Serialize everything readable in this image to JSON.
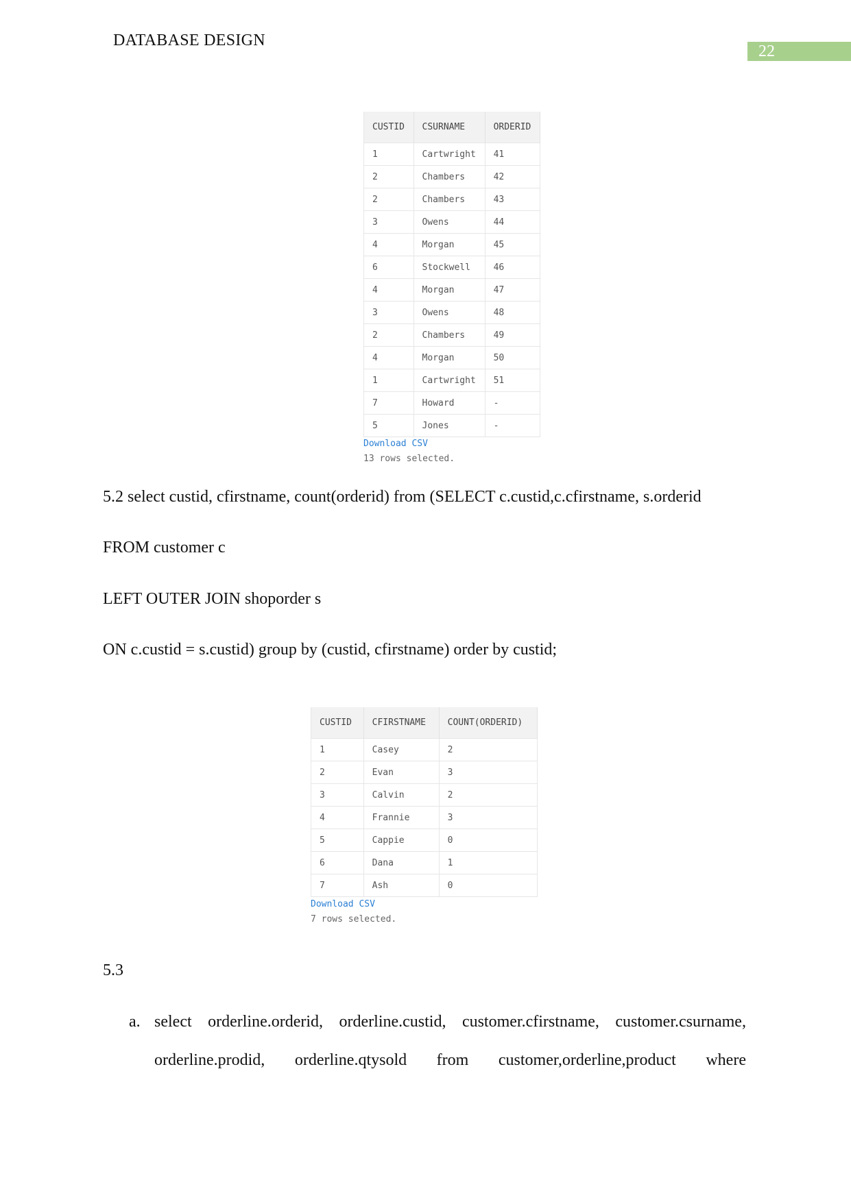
{
  "header": {
    "title": "DATABASE DESIGN",
    "page_number": "22"
  },
  "table1": {
    "columns": [
      "CUSTID",
      "CSURNAME",
      "ORDERID"
    ],
    "rows": [
      [
        "1",
        "Cartwright",
        "41"
      ],
      [
        "2",
        "Chambers",
        "42"
      ],
      [
        "2",
        "Chambers",
        "43"
      ],
      [
        "3",
        "Owens",
        "44"
      ],
      [
        "4",
        "Morgan",
        "45"
      ],
      [
        "6",
        "Stockwell",
        "46"
      ],
      [
        "4",
        "Morgan",
        "47"
      ],
      [
        "3",
        "Owens",
        "48"
      ],
      [
        "2",
        "Chambers",
        "49"
      ],
      [
        "4",
        "Morgan",
        "50"
      ],
      [
        "1",
        "Cartwright",
        "51"
      ],
      [
        "7",
        "Howard",
        "-"
      ],
      [
        "5",
        "Jones",
        "-"
      ]
    ],
    "download": "Download CSV",
    "status": "13 rows selected."
  },
  "query52": [
    "5.2 select custid, cfirstname, count(orderid) from (SELECT c.custid,c.cfirstname, s.orderid",
    "FROM customer c",
    "LEFT OUTER JOIN shoporder s",
    "ON c.custid = s.custid) group by (custid, cfirstname) order by custid;"
  ],
  "table2": {
    "columns": [
      "CUSTID",
      "CFIRSTNAME",
      "COUNT(ORDERID)"
    ],
    "rows": [
      [
        "1",
        "Casey",
        "2"
      ],
      [
        "2",
        "Evan",
        "3"
      ],
      [
        "3",
        "Calvin",
        "2"
      ],
      [
        "4",
        "Frannie",
        "3"
      ],
      [
        "5",
        "Cappie",
        "0"
      ],
      [
        "6",
        "Dana",
        "1"
      ],
      [
        "7",
        "Ash",
        "0"
      ]
    ],
    "download": "Download CSV",
    "status": "7 rows selected."
  },
  "section53": {
    "heading": "5.3",
    "item_marker": "a.",
    "line1": [
      "select",
      "orderline.orderid,",
      "orderline.custid,",
      "customer.cfirstname,",
      "customer.csurname,"
    ],
    "line2": [
      "orderline.prodid,",
      "orderline.qtysold",
      "from",
      "customer,orderline,product",
      "where"
    ]
  }
}
